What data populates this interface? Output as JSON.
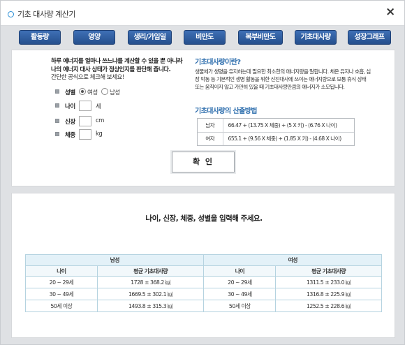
{
  "window": {
    "title": "기초 대사량 계산기",
    "close": "×"
  },
  "tabs": [
    "활동량",
    "영양",
    "생리/가임일",
    "비만도",
    "복부비만도",
    "기초대사량",
    "성장그래프"
  ],
  "form": {
    "intro_line1": "하루 에너지를 얼마나 쓰느냐를 계산할 수 있을 뿐 아니라",
    "intro_line2": "나의 에너지 대사 상태가 정상인지를 판단해 줍니다.",
    "intro_sub": "간단한 공식으로 체크해 보세요!",
    "gender_label": "성별",
    "female_label": "여성",
    "male_label": "남성",
    "selected_gender": "female",
    "age_label": "나이",
    "age_unit": "세",
    "height_label": "신장",
    "height_unit": "cm",
    "weight_label": "체중",
    "weight_unit": "kg",
    "age_value": "",
    "height_value": "",
    "weight_value": ""
  },
  "info": {
    "what_title": "기초대사량이란?",
    "what_desc": "생물체가 생명을 유지하는데 필요한 최소한의 에너지량을 말합니다. 체온 유지나 호흡, 심장 박동 등 기본적인 생명 활동을 위한 신진대사에 쓰이는 에너지량으로 보통 휴식 상태 또는 움직이지 않고 가만히 있을 때 기초대사량만큼의 에너지가 소모됩니다.",
    "method_title": "기초대사량의 산출방법",
    "formulas": [
      {
        "who": "남자",
        "expr": "66.47 + (13.75 X 체중) + (5 X 키) - (6.76 X 나이)"
      },
      {
        "who": "여자",
        "expr": "655.1 + (9.56 X 체중) + (1.85 X 키) - (4.68 X 나이)"
      }
    ]
  },
  "confirm_label": "확 인",
  "result": {
    "prompt": "나이, 신장, 체중, 성별을 입력해 주세요."
  },
  "table": {
    "male_header": "남성",
    "female_header": "여성",
    "age_col": "나이",
    "avg_col": "평균 기초대사량",
    "rows": [
      {
        "m_age": "20 ~ 29세",
        "m_avg": "1728 ± 368.2 ㎉",
        "f_age": "20 ~ 29세",
        "f_avg": "1311.5 ± 233.0 ㎉"
      },
      {
        "m_age": "30 ~ 49세",
        "m_avg": "1669.5 ± 302.1 ㎉",
        "f_age": "30 ~ 49세",
        "f_avg": "1316.8 ± 225.9 ㎉"
      },
      {
        "m_age": "50세 이상",
        "m_avg": "1493.8 ± 315.3 ㎉",
        "f_age": "50세 이상",
        "f_avg": "1252.5 ± 228.6 ㎉"
      }
    ]
  },
  "colors": {
    "tab_bg": "#2d5ea4",
    "accent_blue": "#2f6fae",
    "table_header": "#e3f1f8",
    "table_border": "#b5d3e0"
  }
}
